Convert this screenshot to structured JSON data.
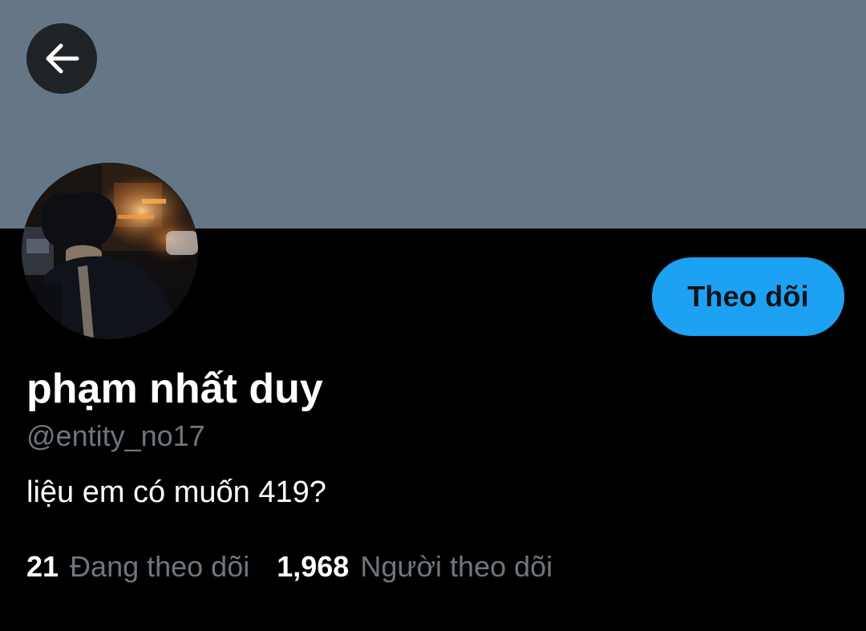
{
  "header": {
    "back_icon": "arrow-left-icon",
    "banner_color": "#657786"
  },
  "profile": {
    "display_name": "phạm nhất duy",
    "handle": "@entity_no17",
    "bio": "liệu em có muốn 419?",
    "follow_label": "Theo dõi",
    "accent": "#1da1f2"
  },
  "stats": {
    "following_count": "21",
    "following_label": "Đang theo dõi",
    "followers_count": "1,968",
    "followers_label": "Người theo dõi"
  }
}
